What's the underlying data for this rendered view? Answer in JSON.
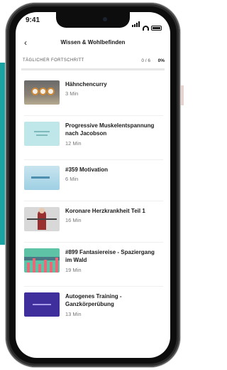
{
  "status_bar": {
    "time": "9:41"
  },
  "nav": {
    "back_label": "‹",
    "title": "Wissen & Wohlbefinden"
  },
  "progress": {
    "label": "TÄGLICHER FORTSCHRITT",
    "count": "0 / 6",
    "percent": "0%",
    "fraction": 0
  },
  "items": [
    {
      "title": "Hähnchencurry",
      "duration": "3 Min",
      "thumbnail": "curry-video-thumb"
    },
    {
      "title": "Progressive Muskelentspannung nach Jacobson",
      "duration": "12 Min",
      "thumbnail": "relaxation-video-thumb"
    },
    {
      "title": "#359 Motivation",
      "duration": "6 Min",
      "thumbnail": "motivation-video-thumb"
    },
    {
      "title": "Koronare Herzkrankheit Teil 1",
      "duration": "16 Min",
      "thumbnail": "heart-disease-video-thumb"
    },
    {
      "title": "#899 Fantasiereise - Spaziergang im Wald",
      "duration": "19 Min",
      "thumbnail": "forest-journey-video-thumb"
    },
    {
      "title": "Autogenes Training - Ganzkörperübung",
      "duration": "13 Min",
      "thumbnail": "autogenic-training-video-thumb"
    }
  ],
  "colors": {
    "accent": "#1aa3a3",
    "background": "#ffffff",
    "text": "#1a1a1a",
    "muted": "#777777"
  }
}
